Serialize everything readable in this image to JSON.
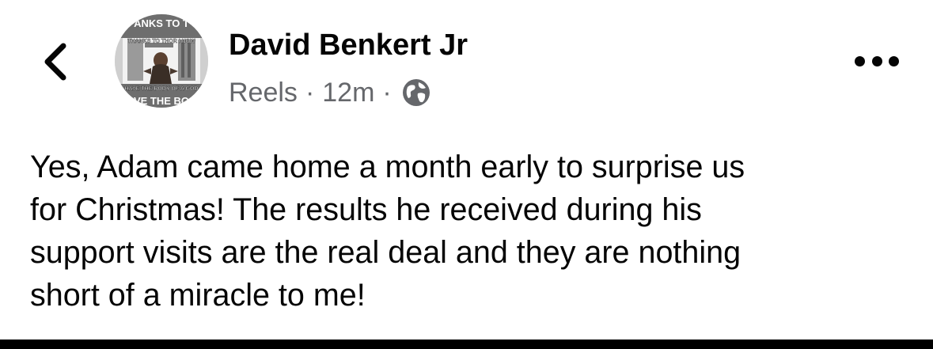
{
  "header": {
    "back_icon": "chevron-left-icon",
    "author_name": "David Benkert Jr",
    "avatar": {
      "caption_top": "THANKS TO THOR I NOW",
      "caption_bottom": "HAVE THE BODY OF A GOD",
      "rim_top": "ANKS TO T",
      "rim_bottom": "VE THE BO"
    },
    "meta": {
      "source": "Reels",
      "separator": "·",
      "time": "12m",
      "privacy_icon": "globe-icon"
    },
    "more_icon": "more-dots-icon"
  },
  "post": {
    "lines": [
      "Yes, Adam came home a month early to surprise us",
      "for Christmas! The results he received during his",
      "support visits are the real deal and they are nothing",
      "short of a miracle to me!"
    ]
  },
  "colors": {
    "text_primary": "#050505",
    "text_secondary": "#65676b",
    "background": "#ffffff"
  }
}
